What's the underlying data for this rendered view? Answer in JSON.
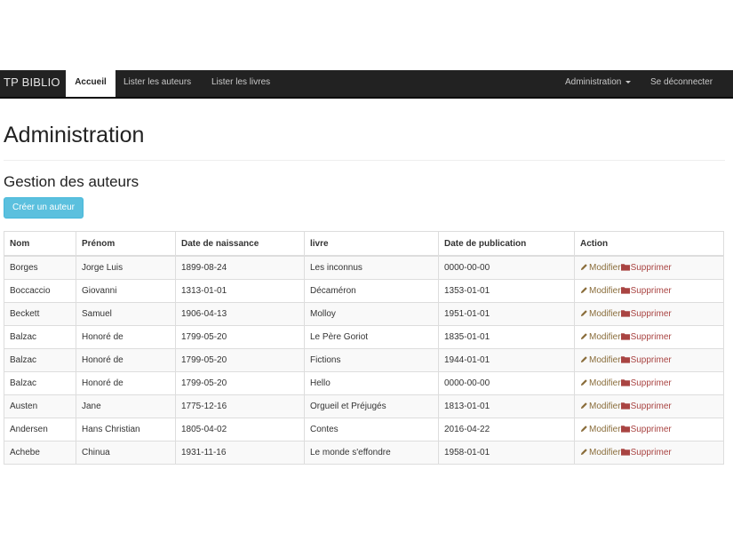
{
  "navbar": {
    "brand": "TP BIBLIO",
    "items": [
      {
        "label": "Accueil"
      },
      {
        "label": "Lister les auteurs"
      },
      {
        "label": "Lister les livres"
      }
    ],
    "admin_menu": "Administration",
    "logout": "Se déconnecter"
  },
  "page": {
    "title": "Administration",
    "section_title": "Gestion des auteurs",
    "create_button": "Créer un auteur"
  },
  "table": {
    "headers": [
      "Nom",
      "Prénom",
      "Date de naissance",
      "livre",
      "Date de publication",
      "Action"
    ],
    "action_edit": "Modifier",
    "action_delete": "Supprimer",
    "rows": [
      [
        "Borges",
        "Jorge Luis",
        "1899-08-24",
        "Les inconnus",
        "0000-00-00"
      ],
      [
        "Boccaccio",
        "Giovanni",
        "1313-01-01",
        "Décaméron",
        "1353-01-01"
      ],
      [
        "Beckett",
        "Samuel",
        "1906-04-13",
        "Molloy",
        "1951-01-01"
      ],
      [
        "Balzac",
        "Honoré de",
        "1799-05-20",
        "Le Père Goriot",
        "1835-01-01"
      ],
      [
        "Balzac",
        "Honoré de",
        "1799-05-20",
        "Fictions",
        "1944-01-01"
      ],
      [
        "Balzac",
        "Honoré de",
        "1799-05-20",
        "Hello",
        "0000-00-00"
      ],
      [
        "Austen",
        "Jane",
        "1775-12-16",
        "Orgueil et Préjugés",
        "1813-01-01"
      ],
      [
        "Andersen",
        "Hans Christian",
        "1805-04-02",
        "Contes",
        "2016-04-22"
      ],
      [
        "Achebe",
        "Chinua",
        "1931-11-16",
        "Le monde s'effondre",
        "1958-01-01"
      ]
    ]
  },
  "colors": {
    "navbar_bg": "#222222",
    "button_info": "#5bc0de",
    "edit_link": "#8a6d3b",
    "delete_link": "#a94442"
  },
  "icons": {
    "edit": "pencil-icon",
    "delete": "folder-icon"
  }
}
